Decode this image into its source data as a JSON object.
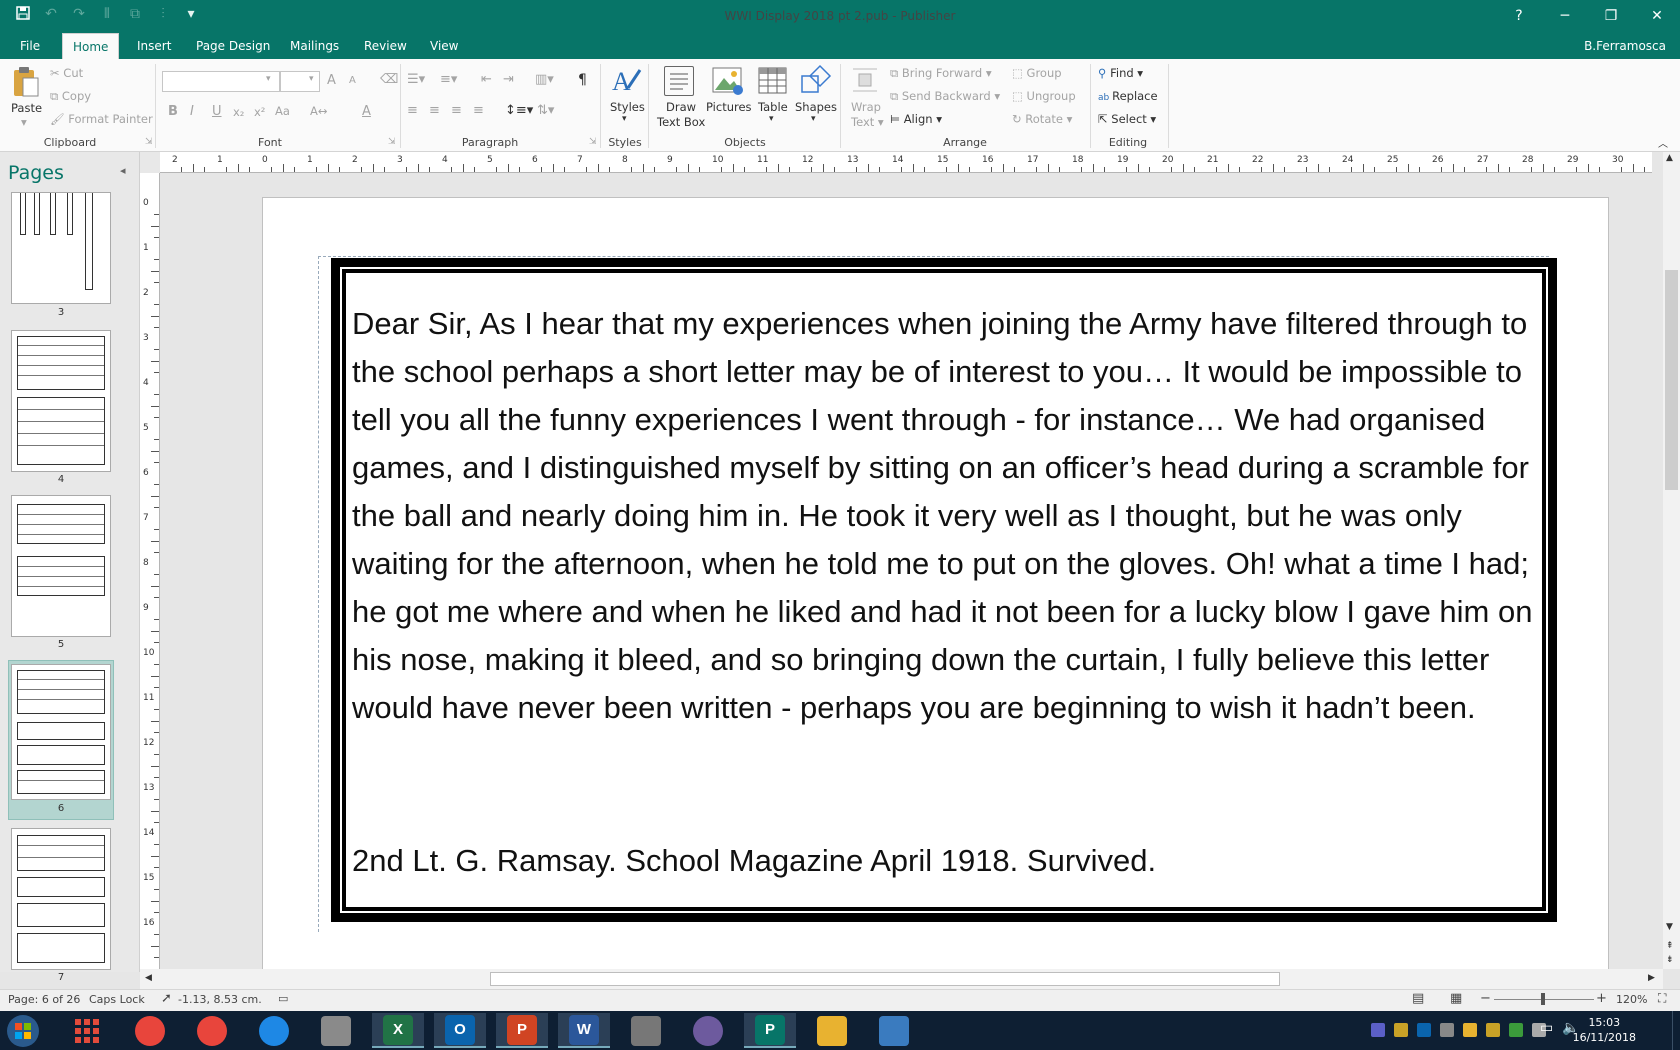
{
  "window": {
    "title": "WWI Display 2018 pt 2.pub - Publisher",
    "user": "B.Ferramosca",
    "help": "?",
    "minimize": "─",
    "restore": "❐",
    "close": "✕"
  },
  "tabs": [
    "File",
    "Home",
    "Insert",
    "Page Design",
    "Mailings",
    "Review",
    "View"
  ],
  "ribbon": {
    "clipboard": {
      "paste": "Paste",
      "cut": "Cut",
      "copy": "Copy",
      "format_painter": "Format Painter",
      "label": "Clipboard"
    },
    "font": {
      "label": "Font",
      "bold": "B",
      "italic": "I",
      "underline": "U",
      "subscript": "x₂",
      "superscript": "x²",
      "change_case": "Aa",
      "grow": "A",
      "shrink": "A",
      "font_color": "A"
    },
    "paragraph": {
      "label": "Paragraph",
      "pilcrow": "¶"
    },
    "styles": {
      "button": "Styles",
      "label": "Styles"
    },
    "objects": {
      "draw_text_box": "Draw\nText Box",
      "draw_line1": "Draw",
      "draw_line2": "Text Box",
      "pictures": "Pictures",
      "table": "Table",
      "shapes": "Shapes",
      "label": "Objects"
    },
    "arrange": {
      "wrap_text1": "Wrap",
      "wrap_text2": "Text",
      "bring_forward": "Bring Forward",
      "send_backward": "Send Backward",
      "align": "Align",
      "group": "Group",
      "ungroup": "Ungroup",
      "rotate": "Rotate",
      "label": "Arrange"
    },
    "editing": {
      "find": "Find",
      "replace": "Replace",
      "select": "Select",
      "label": "Editing"
    }
  },
  "pages_pane": {
    "title": "Pages",
    "thumbnails": [
      "3",
      "4",
      "5",
      "6",
      "7"
    ],
    "selected": "6"
  },
  "ruler_top": [
    "2",
    "1",
    "0",
    "1",
    "2",
    "3",
    "4",
    "5",
    "6",
    "7",
    "8",
    "9",
    "10",
    "11",
    "12",
    "13",
    "14",
    "15",
    "16",
    "17",
    "18",
    "19",
    "20",
    "21",
    "22",
    "23",
    "24",
    "25",
    "26",
    "27",
    "28",
    "29",
    "30"
  ],
  "ruler_left": [
    "0",
    "1",
    "2",
    "3",
    "4",
    "5",
    "6",
    "7",
    "8",
    "9",
    "10",
    "11",
    "12",
    "13",
    "14",
    "15",
    "16"
  ],
  "document": {
    "letter": "Dear Sir, As I hear that my experiences when joining the Army have filtered through to the school perhaps a short letter may be of interest to you… It would be impossible to tell you all the funny experiences I went through - for instance… We had organised games, and I distinguished myself by sitting on an officer’s head during a scramble for the ball and nearly doing him in. He took it very well as I thought, but he was only waiting for the afternoon, when he told me to put on the gloves. Oh! what a time I had; he got me where and when he liked and had it not been for a lucky blow I gave him on his nose, making it bleed, and so bringing down the curtain, I fully believe this letter would have never been written - perhaps you are beginning to wish it hadn’t been.",
    "signature": "2nd Lt. G. Ramsay. School Magazine April 1918. Survived."
  },
  "status": {
    "page": "Page: 6 of 26",
    "caps": "Caps Lock",
    "position": "-1.13, 8.53 cm.",
    "zoom": "120%"
  },
  "taskbar": {
    "time": "15:03",
    "date": "16/11/2018",
    "apps": [
      {
        "name": "chrome",
        "color": "#e8453c"
      },
      {
        "name": "chrome-2",
        "color": "#e8453c"
      },
      {
        "name": "internet-explorer",
        "color": "#1e88e5"
      },
      {
        "name": "settings",
        "color": "#8a8a8a"
      },
      {
        "name": "excel",
        "color": "#217346",
        "glyph": "X"
      },
      {
        "name": "outlook",
        "color": "#0a64ad",
        "glyph": "O"
      },
      {
        "name": "powerpoint",
        "color": "#d04423",
        "glyph": "P"
      },
      {
        "name": "word",
        "color": "#2b579a",
        "glyph": "W"
      },
      {
        "name": "camera",
        "color": "#777777"
      },
      {
        "name": "disc",
        "color": "#6d5a9e"
      },
      {
        "name": "publisher",
        "color": "#077568",
        "glyph": "P"
      },
      {
        "name": "file-explorer",
        "color": "#e8b230"
      },
      {
        "name": "photos",
        "color": "#3a7bbf"
      }
    ]
  }
}
